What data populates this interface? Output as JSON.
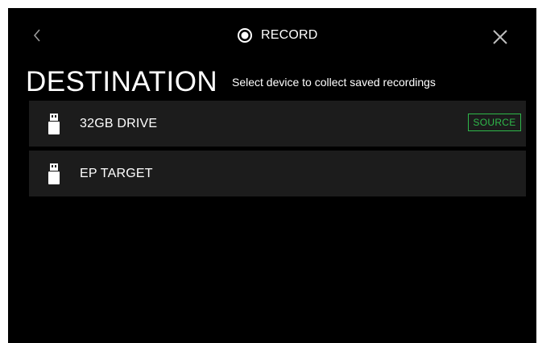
{
  "header": {
    "title": "RECORD",
    "back_icon": "chevron-left-icon",
    "close_icon": "close-icon",
    "record_icon": "record-icon"
  },
  "page": {
    "title": "DESTINATION",
    "subtitle": "Select device to collect saved recordings"
  },
  "devices": [
    {
      "label": "32GB DRIVE",
      "icon": "usb-drive-icon",
      "badge": "SOURCE"
    },
    {
      "label": "EP TARGET",
      "icon": "usb-drive-icon",
      "badge": ""
    }
  ],
  "colors": {
    "background": "#000000",
    "row": "#1c1c1c",
    "accent": "#2fb84a",
    "text": "#ffffff"
  }
}
